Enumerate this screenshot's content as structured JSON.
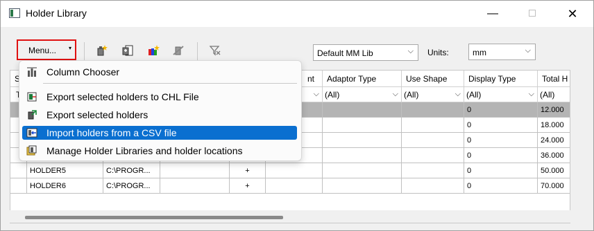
{
  "window": {
    "title": "Holder Library",
    "minimize": "—",
    "close": "✕"
  },
  "toolbar": {
    "menu_label": "Menu...",
    "menu_arrow": "▾",
    "library_value": "Default MM Lib",
    "units_label": "Units:",
    "units_value": "mm"
  },
  "menu": {
    "items": [
      {
        "label": "Column Chooser",
        "icon": "column-chooser-icon"
      },
      {
        "label": "Export selected holders to CHL File",
        "icon": "export-chl-icon"
      },
      {
        "label": "Export selected holders",
        "icon": "export-holders-icon"
      },
      {
        "label": "Import holders from a CSV file",
        "icon": "import-csv-icon",
        "highlighted": true
      },
      {
        "label": "Manage Holder Libraries and holder locations",
        "icon": "manage-libraries-icon"
      }
    ]
  },
  "grid": {
    "headers": {
      "first_fragment": "S",
      "col_t_fragment": "nt",
      "adaptor_type": "Adaptor Type",
      "use_shape": "Use Shape",
      "display_type": "Display Type",
      "total_h": "Total H"
    },
    "filters": {
      "first": "T",
      "all": "(All)"
    },
    "rows": [
      {
        "name": "",
        "path": "",
        "plus": "",
        "display": "0",
        "total": "12.000",
        "selected": true
      },
      {
        "name": "",
        "path": "",
        "plus": "",
        "display": "0",
        "total": "18.000"
      },
      {
        "name": "",
        "path": "",
        "plus": "",
        "display": "0",
        "total": "24.000"
      },
      {
        "name": "",
        "path": "",
        "plus": "",
        "display": "0",
        "total": "36.000"
      },
      {
        "name": "HOLDER5",
        "path": "C:\\PROGR...",
        "plus": "+",
        "display": "0",
        "total": "50.000"
      },
      {
        "name": "HOLDER6",
        "path": "C:\\PROGR...",
        "plus": "+",
        "display": "0",
        "total": "70.000"
      }
    ]
  },
  "colors": {
    "highlight": "#0a6fd0",
    "menu_border": "#e01010",
    "selected_row": "#b4b4b4"
  }
}
